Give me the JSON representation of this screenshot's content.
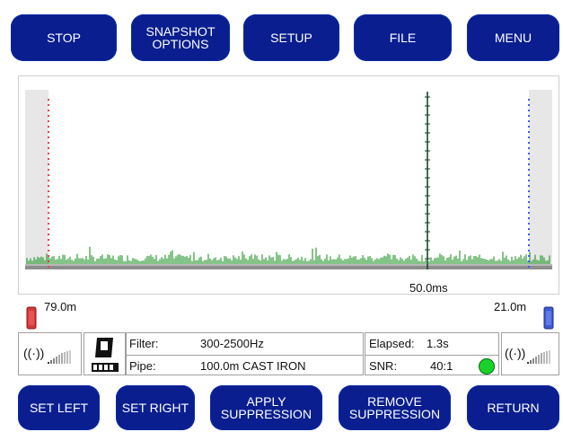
{
  "top_buttons": [
    {
      "label": "STOP"
    },
    {
      "label": "SNAPSHOT\nOPTIONS"
    },
    {
      "label": "SETUP"
    },
    {
      "label": "FILE"
    },
    {
      "label": "MENU"
    }
  ],
  "plot": {
    "time_marker_label": "50.0ms",
    "left_distance": "79.0m",
    "right_distance": "21.0m",
    "colors": {
      "left_cursor": "#ff3b3b",
      "right_cursor": "#3a5bff",
      "peak": "#0f3d1c",
      "signal": "#0a8a12",
      "baseline": "#8d8d8d"
    }
  },
  "status": {
    "filter_label": "Filter:",
    "filter_value": "300-2500Hz",
    "pipe_label": "Pipe:",
    "pipe_value": "100.0m CAST IRON",
    "elapsed_label": "Elapsed:",
    "elapsed_value": "1.3s",
    "snr_label": "SNR:",
    "snr_value": "40:1",
    "indicator_color": "#19d12a"
  },
  "bottom_buttons": [
    {
      "label": "SET LEFT"
    },
    {
      "label": "SET RIGHT"
    },
    {
      "label": "APPLY\nSUPPRESSION"
    },
    {
      "label": "REMOVE\nSUPPRESSION"
    },
    {
      "label": "RETURN"
    }
  ]
}
